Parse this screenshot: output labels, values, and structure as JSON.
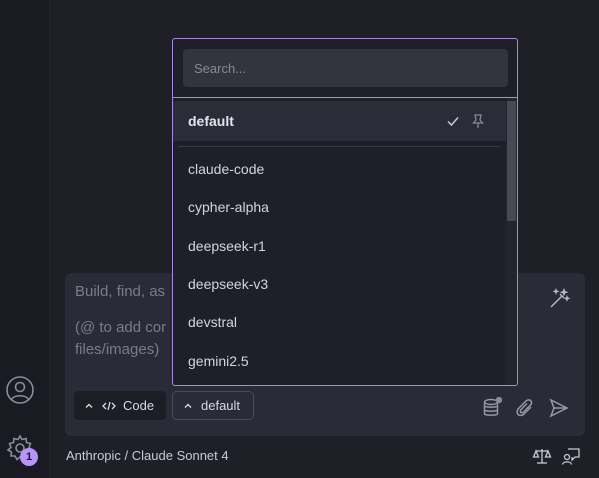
{
  "chat": {
    "placeholder_line1": "Build, find, as",
    "placeholder_line2": "(@ to add cor",
    "placeholder_line3": "files/images)",
    "mode_pill_label": "Code",
    "model_pill_label": "default"
  },
  "status": {
    "model_label": "Anthropic / Claude Sonnet 4"
  },
  "sidebar": {
    "settings_badge": "1"
  },
  "dropdown": {
    "search_placeholder": "Search...",
    "selected": "default",
    "items": [
      "claude-code",
      "cypher-alpha",
      "deepseek-r1",
      "deepseek-v3",
      "devstral",
      "gemini2.5"
    ]
  },
  "icons": {
    "account": "account-icon",
    "settings": "gear-icon",
    "magic": "magic-wand-icon",
    "code": "code-brackets-icon",
    "database": "database-icon",
    "attach": "paperclip-icon",
    "send": "send-icon",
    "scales": "scales-icon",
    "feedback": "feedback-icon",
    "check": "check-icon",
    "pin": "pin-icon"
  },
  "colors": {
    "accent": "#a78bda",
    "badge": "#b794f6",
    "background": "#1f1f28"
  }
}
